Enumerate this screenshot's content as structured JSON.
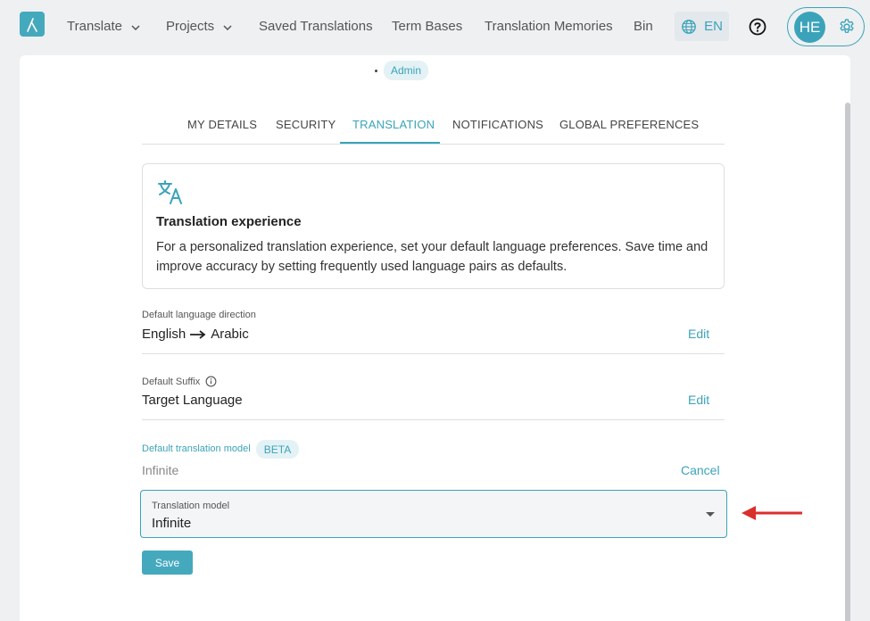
{
  "nav": {
    "items": [
      {
        "label": "Translate",
        "has_dropdown": true
      },
      {
        "label": "Projects",
        "has_dropdown": true
      },
      {
        "label": "Saved Translations",
        "has_dropdown": false
      },
      {
        "label": "Term Bases",
        "has_dropdown": false
      },
      {
        "label": "Translation Memories",
        "has_dropdown": false
      },
      {
        "label": "Bin",
        "has_dropdown": false
      }
    ],
    "language": "EN",
    "avatar_initials": "HE"
  },
  "profile": {
    "role": "Admin"
  },
  "tabs": [
    {
      "label": "MY DETAILS",
      "active": false
    },
    {
      "label": "SECURITY",
      "active": false
    },
    {
      "label": "TRANSLATION",
      "active": true
    },
    {
      "label": "NOTIFICATIONS",
      "active": false
    },
    {
      "label": "GLOBAL PREFERENCES",
      "active": false
    }
  ],
  "info": {
    "title": "Translation experience",
    "text": "For a personalized translation experience, set your default language preferences. Save time and improve accuracy by setting frequently used language pairs as defaults."
  },
  "fields": {
    "direction": {
      "label": "Default language direction",
      "source": "English",
      "target": "Arabic",
      "action": "Edit"
    },
    "suffix": {
      "label": "Default Suffix",
      "value": "Target Language",
      "action": "Edit"
    },
    "model": {
      "label": "Default translation model",
      "badge": "BETA",
      "current": "Infinite",
      "cancel": "Cancel",
      "select_label": "Translation model",
      "select_value": "Infinite",
      "save": "Save"
    }
  },
  "colors": {
    "accent": "#3ba3b9",
    "annotation_arrow": "#d9302c"
  }
}
